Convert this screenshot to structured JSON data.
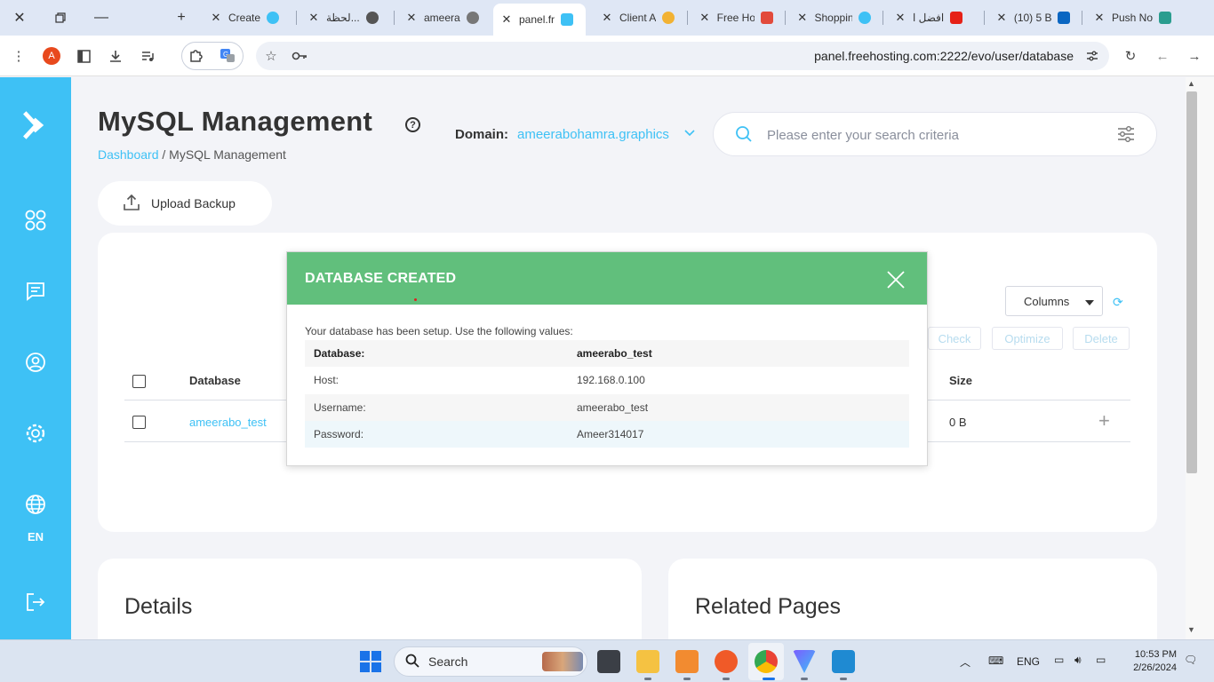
{
  "browser": {
    "tabs": [
      {
        "title": "Create",
        "active": false
      },
      {
        "title": "لحظة...",
        "active": false
      },
      {
        "title": "ameera",
        "active": false
      },
      {
        "title": "panel.fr",
        "active": true
      },
      {
        "title": "Client A",
        "active": false
      },
      {
        "title": "Free Ho",
        "active": false
      },
      {
        "title": "Shoppin",
        "active": false
      },
      {
        "title": "افضل ا",
        "active": false
      },
      {
        "title": "(10) 5 B",
        "active": false
      },
      {
        "title": "Push No",
        "active": false
      }
    ],
    "new_tab_label": "+",
    "profile_initial": "A",
    "url": "panel.freehosting.com:2222/evo/user/database"
  },
  "sidebar": {
    "language": "EN",
    "items": [
      {
        "icon": "logo-arrow-icon"
      },
      {
        "icon": "dashboard-grid-icon"
      },
      {
        "icon": "message-icon"
      },
      {
        "icon": "user-icon"
      },
      {
        "icon": "settings-gear-icon"
      },
      {
        "icon": "globe-icon"
      },
      {
        "icon": "logout-icon"
      }
    ]
  },
  "header": {
    "title": "MySQL Management",
    "breadcrumb_root": "Dashboard",
    "breadcrumb_sep": " / ",
    "breadcrumb_current": "MySQL Management",
    "domain_label": "Domain:",
    "domain_value": "ameerabohamra.graphics",
    "search_placeholder": "Please enter your search criteria"
  },
  "toolbar": {
    "upload_label": "Upload Backup",
    "columns_label": "Columns",
    "actions": [
      "Check",
      "Optimize",
      "Delete"
    ]
  },
  "table": {
    "headers": {
      "database": "Database",
      "size": "Size"
    },
    "rows": [
      {
        "database": "ameerabo_test",
        "size": "0 B"
      }
    ]
  },
  "bottom": {
    "details_title": "Details",
    "related_title": "Related Pages"
  },
  "modal": {
    "title": "DATABASE CREATED",
    "intro": "Your database has been setup. Use the following values:",
    "rows": [
      {
        "key": "Database:",
        "value": "ameerabo_test"
      },
      {
        "key": "Host:",
        "value": "192.168.0.100"
      },
      {
        "key": "Username:",
        "value": "ameerabo_test"
      },
      {
        "key": "Password:",
        "value": "Ameer314017"
      }
    ]
  },
  "taskbar": {
    "search_label": "Search",
    "language": "ENG",
    "time": "10:53 PM",
    "date": "2/26/2024"
  },
  "colors": {
    "accent": "#3ec1f5",
    "modal_header": "#61bf7c",
    "disabled_action": "#b7dcef"
  }
}
